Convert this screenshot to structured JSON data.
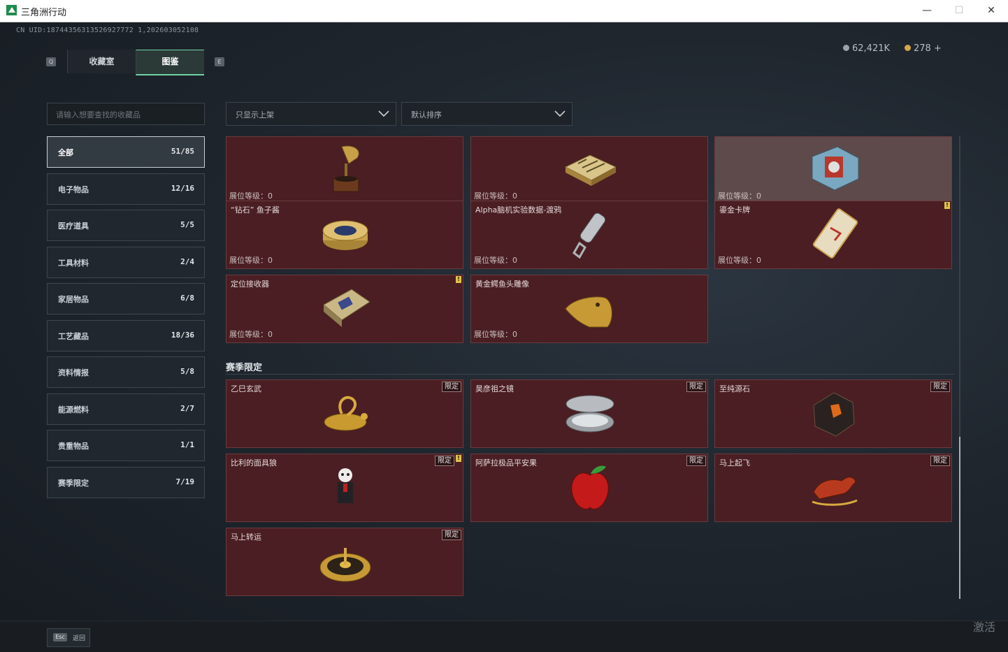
{
  "window": {
    "title": "三角洲行动",
    "minimize": "—",
    "maximize": "☐",
    "close": "✕"
  },
  "uid_line": "CN UID:18744356313526927772 1,202603052108",
  "tabs": {
    "left_key": "Q",
    "right_key": "E",
    "items": [
      "收藏室",
      "图鉴"
    ],
    "active": "图鉴"
  },
  "currency": [
    {
      "value": "62,421K",
      "color": "#9aa3aa"
    },
    {
      "value": "278 +",
      "color": "#d4a84a"
    }
  ],
  "search": {
    "placeholder": "请输入想要查找的收藏品"
  },
  "categories": [
    {
      "label": "全部",
      "count": "51/85",
      "active": true
    },
    {
      "label": "电子物品",
      "count": "12/16"
    },
    {
      "label": "医疗道具",
      "count": "5/5"
    },
    {
      "label": "工具材料",
      "count": "2/4"
    },
    {
      "label": "家居物品",
      "count": "6/8"
    },
    {
      "label": "工艺藏品",
      "count": "18/36"
    },
    {
      "label": "资料情报",
      "count": "5/8"
    },
    {
      "label": "能源燃料",
      "count": "2/7"
    },
    {
      "label": "贵重物品",
      "count": "1/1"
    },
    {
      "label": "赛季限定",
      "count": "7/19"
    }
  ],
  "filters": {
    "show": "只显示上架",
    "sort": "默认排序"
  },
  "level_label": "展位等级：0",
  "limited_label": "限定",
  "alert_mark": "!",
  "items": [
    {
      "name": "",
      "icon": "gramophone-icon"
    },
    {
      "name": "",
      "icon": "chessboard-icon"
    },
    {
      "name": "",
      "icon": "machine-part-icon"
    },
    {
      "name": "“钻石” 鱼子酱",
      "icon": "caviar-tin-icon"
    },
    {
      "name": "Alpha脑机实验数据-渡鸦",
      "icon": "data-drive-icon"
    },
    {
      "name": "鎏金卡牌",
      "icon": "gilded-card-icon"
    },
    {
      "name": "定位接收器",
      "icon": "locator-receiver-icon"
    },
    {
      "name": "黄金鳄鱼头雕像",
      "icon": "gold-crocodile-icon"
    }
  ],
  "season_section": {
    "title": "赛季限定"
  },
  "season_items": [
    {
      "name": "乙巳玄武",
      "icon": "gold-turtle-icon"
    },
    {
      "name": "昊彦祖之镜",
      "icon": "compact-mirror-icon"
    },
    {
      "name": "至纯源石",
      "icon": "pure-stone-icon"
    },
    {
      "name": "比利的面具狼",
      "icon": "puppet-figure-icon"
    },
    {
      "name": "阿萨拉极品平安果",
      "icon": "red-apple-icon"
    },
    {
      "name": "马上起飞",
      "icon": "red-horse-icon"
    },
    {
      "name": "马上转运",
      "icon": "gold-wheel-icon"
    }
  ],
  "footer": {
    "esc_key": "Esc",
    "esc_label": "返回"
  },
  "watermark": "激活"
}
